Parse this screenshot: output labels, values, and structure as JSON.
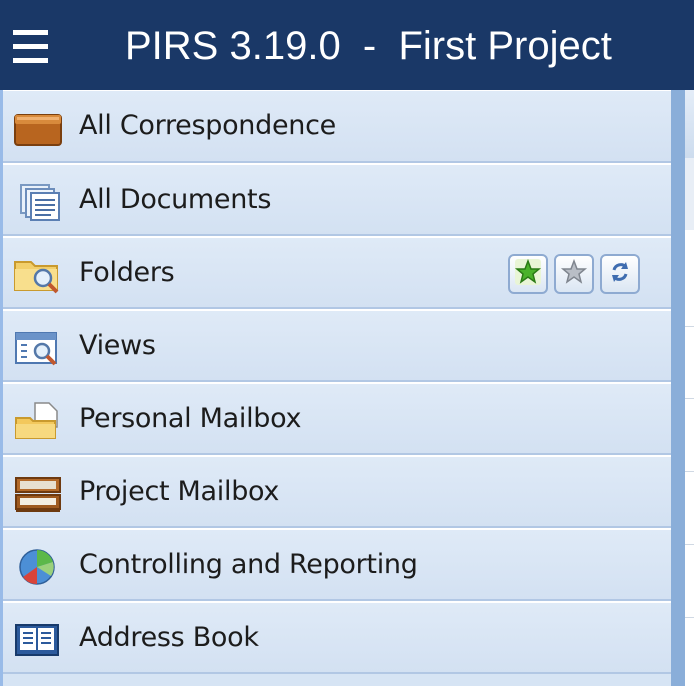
{
  "window": {
    "title": "PIRS 3.19.0  -  First Project"
  },
  "nav": {
    "items": [
      {
        "label": "All Correspondence",
        "icon": "folder-box-icon"
      },
      {
        "label": "All Documents",
        "icon": "documents-icon"
      },
      {
        "label": "Folders",
        "icon": "folder-search-icon"
      },
      {
        "label": "Views",
        "icon": "views-icon"
      },
      {
        "label": "Personal Mailbox",
        "icon": "personal-mailbox-icon"
      },
      {
        "label": "Project Mailbox",
        "icon": "project-mailbox-icon"
      },
      {
        "label": "Controlling and Reporting",
        "icon": "pie-chart-icon"
      },
      {
        "label": "Address Book",
        "icon": "address-book-icon"
      }
    ],
    "folder_tools": [
      "favorite-add-icon",
      "favorite-icon",
      "refresh-icon"
    ]
  },
  "colors": {
    "titlebar": "#1a3867",
    "nav_background": "#d6e4f4",
    "nav_border": "#99bbe8"
  }
}
